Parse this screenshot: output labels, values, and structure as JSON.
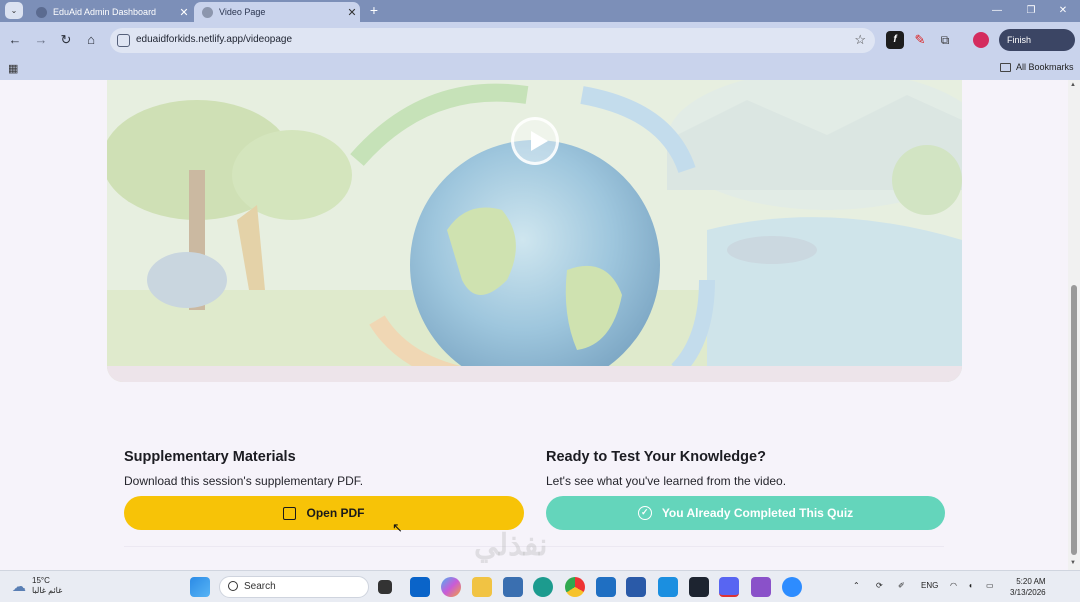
{
  "browser": {
    "tabs": [
      {
        "title": "EduAid Admin Dashboard",
        "active": false
      },
      {
        "title": "Video Page",
        "active": true
      }
    ],
    "new_tab": "+",
    "address": "eduaidforkids.netlify.app/videopage",
    "finish_update": "Finish update",
    "bookmarks_label": "All Bookmarks"
  },
  "page": {
    "supplementary": {
      "title": "Supplementary Materials",
      "description": "Download this session's supplementary PDF.",
      "button": "Open PDF"
    },
    "quiz": {
      "title": "Ready to Test Your Knowledge?",
      "description": "Let's see what you've learned from the video.",
      "button": "You Already Completed This Quiz"
    },
    "watermark": "نفذلي"
  },
  "taskbar": {
    "weather_temp": "15°C",
    "weather_desc": "غائم غالبا",
    "search_placeholder": "Search",
    "language": "ENG",
    "time": "5:20 AM",
    "date": "3/13/2026"
  },
  "colors": {
    "pdf_button": "#f7c307",
    "quiz_button": "#64d5bb",
    "chrome": "#7c8fb8"
  }
}
